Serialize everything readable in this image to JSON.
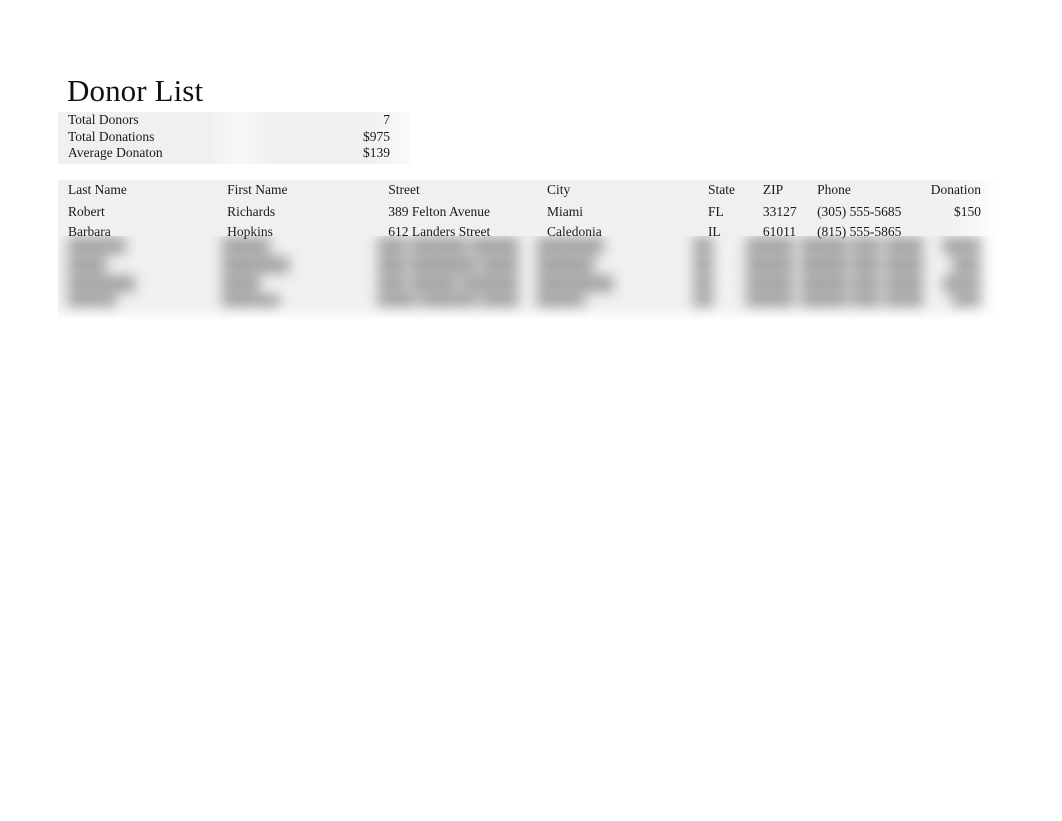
{
  "document": {
    "title": "Donor List"
  },
  "summary": {
    "rows": [
      {
        "label": "Total Donors",
        "value": "7"
      },
      {
        "label": "Total Donations",
        "value": "$975"
      },
      {
        "label": "Average Donaton",
        "value": "$139"
      }
    ]
  },
  "table": {
    "headers": {
      "last_name": "Last Name",
      "first_name": "First Name",
      "street": "Street",
      "city": "City",
      "state": "State",
      "zip": "ZIP",
      "phone": "Phone",
      "donation": "Donation"
    },
    "rows": [
      {
        "last_name": "Robert",
        "first_name": "Richards",
        "street": "389 Felton Avenue",
        "city": "Miami",
        "state": "FL",
        "zip": "33127",
        "phone": "(305) 555-5685",
        "donation": "$150"
      },
      {
        "last_name": "Barbara",
        "first_name": "Hopkins",
        "street": "612 Landers Street",
        "city": "Caledonia",
        "state": "IL",
        "zip": "61011",
        "phone": "(815) 555-5865",
        "donation": ""
      }
    ],
    "obscured_rows": [
      {
        "last_name": "██████",
        "first_name": "█████",
        "street": "███ ██████ █████",
        "city": "███████",
        "state": "██",
        "zip": "█████",
        "phone": "█████ ███-████",
        "donation": "████"
      },
      {
        "last_name": "████",
        "first_name": "███████",
        "street": "███ ███████ ████",
        "city": "██████",
        "state": "██",
        "zip": "█████",
        "phone": "█████ ███-████",
        "donation": "███"
      },
      {
        "last_name": "███████",
        "first_name": "████",
        "street": "███ █████ ██████",
        "city": "████████",
        "state": "██",
        "zip": "█████",
        "phone": "█████ ███-████",
        "donation": "████"
      },
      {
        "last_name": "█████",
        "first_name": "██████",
        "street": "████ ██████ ████",
        "city": "█████",
        "state": "██",
        "zip": "█████",
        "phone": "█████ ███-████",
        "donation": "███"
      }
    ]
  },
  "colors": {
    "page_background": "#ffffff",
    "panel_background": "#f0f0f0",
    "text": "#1a1a1a"
  }
}
